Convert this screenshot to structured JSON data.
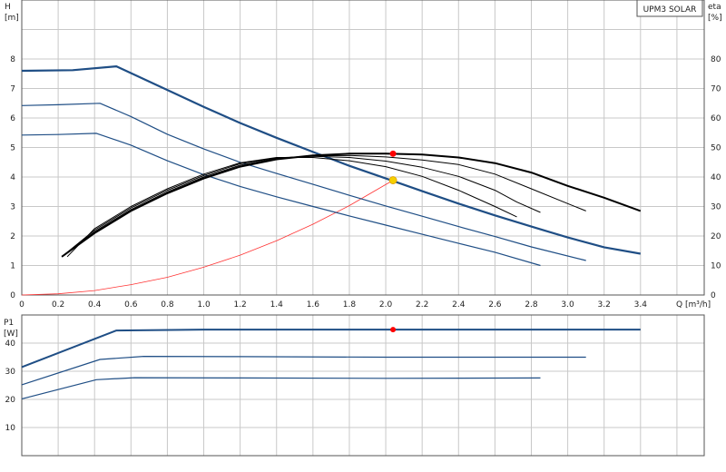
{
  "chart_data": [
    {
      "type": "line",
      "title": "UPM3 SOLAR",
      "xlabel": "Q [m³/h]",
      "ylabel_left": "H\n[m]",
      "ylabel_right": "eta\n[%]",
      "xlim": [
        0,
        3.75
      ],
      "ylim": [
        0,
        10
      ],
      "y2lim": [
        0,
        100
      ],
      "grid": true,
      "xticks": [
        "0",
        "0.2",
        "0.4",
        "0.6",
        "0.8",
        "1.0",
        "1.2",
        "1.4",
        "1.6",
        "1.8",
        "2.0",
        "2.2",
        "2.4",
        "2.6",
        "2.8",
        "3.0",
        "3.2",
        "3.4"
      ],
      "yticks": [
        "0",
        "1",
        "2",
        "3",
        "4",
        "5",
        "6",
        "7",
        "8"
      ],
      "y2ticks": [
        "0",
        "10",
        "20",
        "30",
        "40",
        "50",
        "60",
        "70",
        "80"
      ],
      "head_series": [
        {
          "x": [
            0,
            0.28,
            0.52,
            0.8,
            1.0,
            1.2,
            1.4,
            1.6,
            1.8,
            2.0,
            2.2,
            2.4,
            2.6,
            2.8,
            3.0,
            3.2,
            3.4
          ],
          "y": [
            7.6,
            7.62,
            7.75,
            6.95,
            6.38,
            5.83,
            5.33,
            4.85,
            4.38,
            3.95,
            3.52,
            3.1,
            2.7,
            2.32,
            1.95,
            1.62,
            1.4
          ]
        },
        {
          "x": [
            0,
            0.2,
            0.43,
            0.6,
            0.8,
            1.0,
            1.2,
            1.4,
            1.6,
            1.8,
            2.0,
            2.2,
            2.4,
            2.6,
            2.8,
            3.1
          ],
          "y": [
            6.42,
            6.45,
            6.5,
            6.05,
            5.45,
            4.95,
            4.5,
            4.12,
            3.75,
            3.38,
            3.02,
            2.67,
            2.32,
            1.98,
            1.63,
            1.17
          ]
        },
        {
          "x": [
            0,
            0.2,
            0.41,
            0.6,
            0.8,
            1.0,
            1.2,
            1.4,
            1.6,
            1.8,
            2.0,
            2.2,
            2.4,
            2.6,
            2.85
          ],
          "y": [
            5.42,
            5.44,
            5.48,
            5.08,
            4.55,
            4.08,
            3.68,
            3.33,
            3.0,
            2.68,
            2.37,
            2.06,
            1.75,
            1.45,
            1.0
          ]
        }
      ],
      "efficiency_series": [
        {
          "x": [
            0.22,
            0.4,
            0.6,
            0.8,
            1.0,
            1.2,
            1.4,
            1.6,
            1.8,
            2.0,
            2.2,
            2.4,
            2.6,
            2.8,
            3.0,
            3.2,
            3.4
          ],
          "y": [
            13,
            21,
            28.5,
            34.5,
            39.5,
            43.5,
            46,
            47.3,
            47.9,
            47.9,
            47.6,
            46.6,
            44.7,
            41.5,
            37,
            33,
            28.5
          ]
        },
        {
          "x": [
            0.22,
            0.4,
            0.6,
            0.8,
            1.0,
            1.2,
            1.4,
            1.6,
            1.8,
            2.0,
            2.2,
            2.4,
            2.6,
            2.8,
            3.0,
            3.1
          ],
          "y": [
            13,
            21.5,
            29,
            35,
            40,
            44,
            46.3,
            47.2,
            47.3,
            46.8,
            45.8,
            44.2,
            41,
            36,
            31,
            28.5
          ]
        },
        {
          "x": [
            0.22,
            0.4,
            0.6,
            0.8,
            1.0,
            1.2,
            1.4,
            1.6,
            1.8,
            2.0,
            2.2,
            2.4,
            2.6,
            2.72,
            2.85
          ],
          "y": [
            13,
            22,
            29.5,
            35.5,
            40.5,
            44.5,
            46.5,
            47,
            46.6,
            45.4,
            43.3,
            40.2,
            35.5,
            31.5,
            28
          ]
        },
        {
          "x": [
            0.25,
            0.4,
            0.6,
            0.8,
            1.0,
            1.2,
            1.4,
            1.6,
            1.8,
            2.0,
            2.2,
            2.4,
            2.6,
            2.72
          ],
          "y": [
            13,
            22.5,
            30,
            36,
            41,
            44.8,
            46.6,
            46.6,
            45.5,
            43.5,
            40.2,
            35.5,
            30,
            26.5
          ]
        }
      ],
      "system_curve": {
        "x": [
          0,
          0.2,
          0.4,
          0.6,
          0.8,
          1.0,
          1.2,
          1.4,
          1.6,
          1.8,
          2.04
        ],
        "y": [
          0,
          0.04,
          0.15,
          0.35,
          0.6,
          0.94,
          1.35,
          1.84,
          2.4,
          3.03,
          3.89
        ]
      },
      "duty_point": {
        "x": 2.04,
        "y": 3.89
      },
      "efficiency_point": {
        "x": 2.04,
        "y": 47.9
      },
      "colors": {
        "head": "#1f4e85",
        "efficiency": "#000000",
        "system": "#ff3333",
        "duty": "#f5d000",
        "marker": "#ff0000",
        "grid": "#c8c8c8"
      }
    },
    {
      "type": "line",
      "ylabel": "P1\n[W]",
      "xlim": [
        0,
        3.75
      ],
      "ylim": [
        0,
        50
      ],
      "grid": true,
      "yticks": [
        "10",
        "20",
        "30",
        "40"
      ],
      "power_series": [
        {
          "x": [
            0,
            0.52,
            1.0,
            2.0,
            3.0,
            3.4
          ],
          "y": [
            31.5,
            44.5,
            44.8,
            44.8,
            44.8,
            44.8
          ]
        },
        {
          "x": [
            0,
            0.43,
            0.67,
            1.2,
            2.0,
            3.1
          ],
          "y": [
            25.2,
            34.2,
            35.3,
            35.2,
            35.0,
            35.0
          ]
        },
        {
          "x": [
            0,
            0.41,
            0.62,
            1.2,
            2.0,
            2.85
          ],
          "y": [
            20.2,
            27.0,
            27.7,
            27.6,
            27.5,
            27.6
          ]
        }
      ],
      "operating_point": {
        "x": 2.04,
        "y": 44.8
      },
      "colors": {
        "power": "#1f4e85",
        "marker": "#ff0000"
      }
    }
  ]
}
